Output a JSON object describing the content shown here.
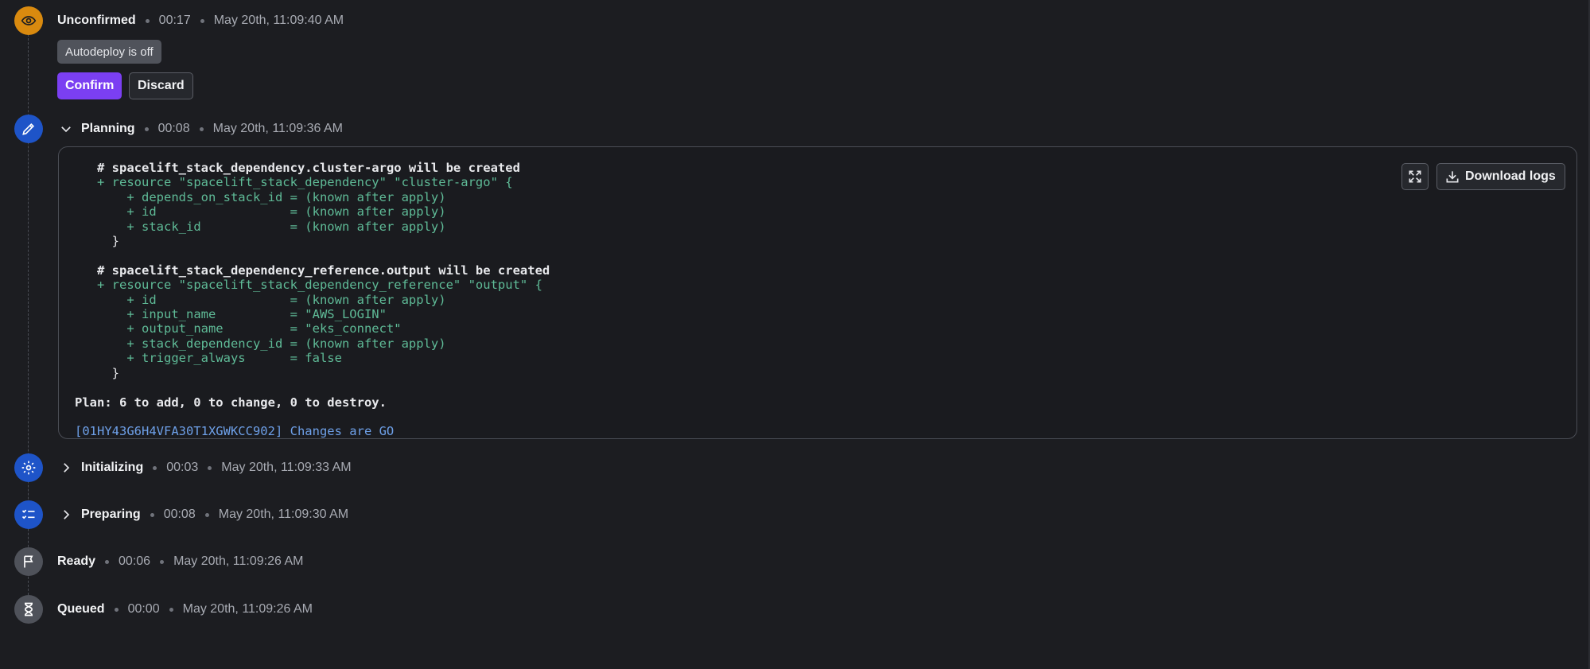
{
  "colors": {
    "unconfirmed": "#d98a0f",
    "active_step": "#1e54c8",
    "inactive_step": "#4f525a",
    "confirm": "#7b3ff2",
    "terminal_plus": "#5fbb97",
    "run_id": "#6ea0e8"
  },
  "steps": [
    {
      "name": "Unconfirmed",
      "duration": "00:17",
      "time": "May 20th, 11:09:40 AM",
      "icon": "eye-icon"
    },
    {
      "name": "Planning",
      "duration": "00:08",
      "time": "May 20th, 11:09:36 AM",
      "icon": "pencil-icon",
      "expanded": true
    },
    {
      "name": "Initializing",
      "duration": "00:03",
      "time": "May 20th, 11:09:33 AM",
      "icon": "gear-icon"
    },
    {
      "name": "Preparing",
      "duration": "00:08",
      "time": "May 20th, 11:09:30 AM",
      "icon": "checklist-icon"
    },
    {
      "name": "Ready",
      "duration": "00:06",
      "time": "May 20th, 11:09:26 AM",
      "icon": "flag-icon"
    },
    {
      "name": "Queued",
      "duration": "00:00",
      "time": "May 20th, 11:09:26 AM",
      "icon": "hourglass-icon"
    }
  ],
  "unconfirmed": {
    "badge": "Autodeploy is off",
    "confirm_label": "Confirm",
    "discard_label": "Discard"
  },
  "logs": {
    "download_label": "Download logs",
    "lines": [
      "# spacelift_stack_dependency.cluster-argo will be created",
      "+ resource \"spacelift_stack_dependency\" \"cluster-argo\" {",
      "+ depends_on_stack_id = (known after apply)",
      "+ id                  = (known after apply)",
      "+ stack_id            = (known after apply)",
      "}",
      "# spacelift_stack_dependency_reference.output will be created",
      "+ resource \"spacelift_stack_dependency_reference\" \"output\" {",
      "+ id                  = (known after apply)",
      "+ input_name          = \"AWS_LOGIN\"",
      "+ output_name         = \"eks_connect\"",
      "+ stack_dependency_id = (known after apply)",
      "+ trigger_always      = false",
      "}",
      "Plan: 6 to add, 0 to change, 0 to destroy.",
      "[01HY43G6H4VFA30T1XGWKCC902] Changes are GO"
    ]
  }
}
